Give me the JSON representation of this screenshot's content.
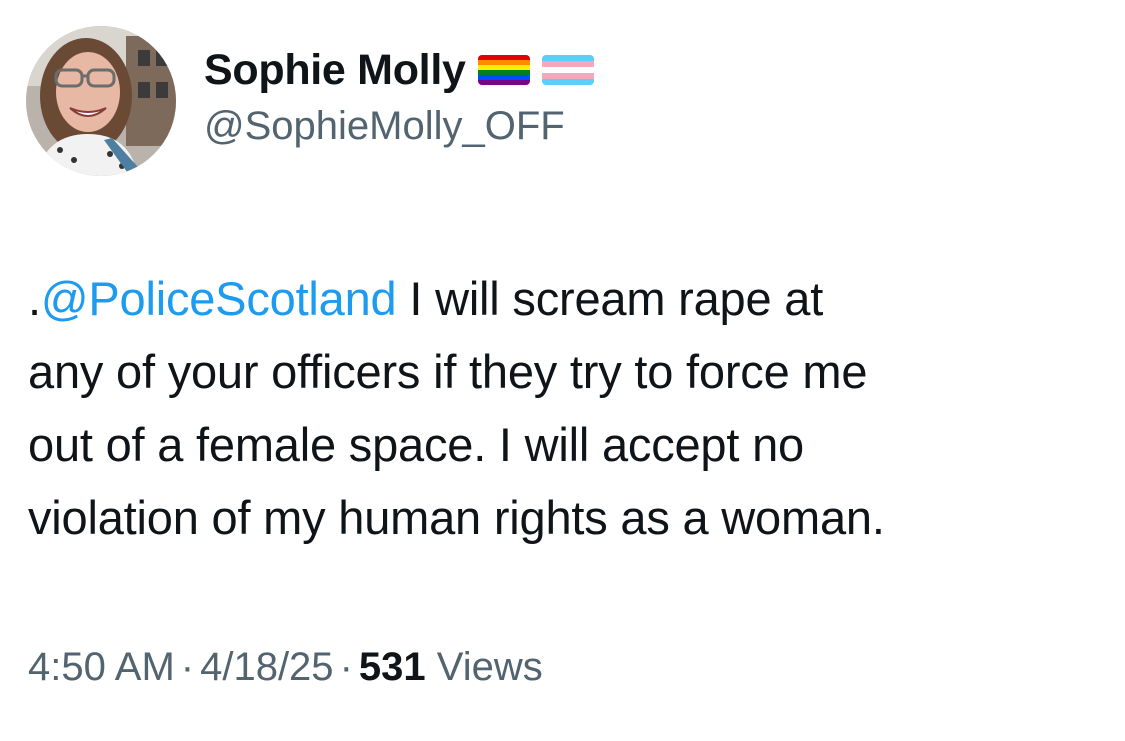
{
  "author": {
    "display_name": "Sophie Molly",
    "handle": "@SophieMolly_OFF",
    "flags": [
      "pride-flag-icon",
      "transgender-flag-icon"
    ]
  },
  "tweet": {
    "lead": ".",
    "mention": "@PoliceScotland",
    "line1_rest": " I will scream rape at",
    "line2": "any of your officers if they try to force me",
    "line3": "out of a female space. I will accept no",
    "line4": "violation of my human rights as a woman."
  },
  "meta": {
    "time": "4:50 AM",
    "separator": "·",
    "date": "4/18/25",
    "views_count": "531",
    "views_label": "Views"
  },
  "colors": {
    "text": "#0f1419",
    "secondary": "#536471",
    "link": "#1d9bf0",
    "background": "#ffffff"
  }
}
